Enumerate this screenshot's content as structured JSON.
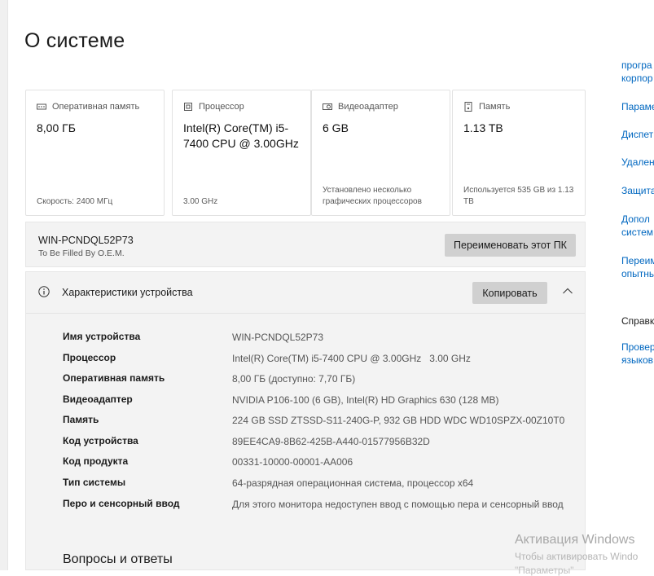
{
  "page": {
    "title": "О системе"
  },
  "cards": [
    {
      "label": "Оперативная память",
      "icon": "ram-icon",
      "value": "8,00 ГБ",
      "foot": "Скорость: 2400 МГц"
    },
    {
      "label": "Процессор",
      "icon": "cpu-icon",
      "value": "Intel(R) Core(TM) i5-7400 CPU @ 3.00GHz",
      "foot": "3.00 GHz"
    },
    {
      "label": "Видеоадаптер",
      "icon": "gpu-icon",
      "value": "6 GB",
      "foot": "Установлено несколько графических процессоров"
    },
    {
      "label": "Память",
      "icon": "storage-icon",
      "value": "1.13 TB",
      "foot": "Используется 535 GB из 1.13 TB"
    }
  ],
  "pc": {
    "name": "WIN-PCNDQL52P73",
    "oem": "To Be Filled By O.E.M.",
    "rename_label": "Переименовать этот ПК"
  },
  "specs": {
    "title": "Характеристики устройства",
    "copy_label": "Копировать",
    "rows": [
      {
        "label": "Имя устройства",
        "value": "WIN-PCNDQL52P73"
      },
      {
        "label": "Процессор",
        "value": "Intel(R) Core(TM) i5-7400 CPU @ 3.00GHz   3.00 GHz"
      },
      {
        "label": "Оперативная память",
        "value": "8,00 ГБ (доступно: 7,70 ГБ)"
      },
      {
        "label": "Видеоадаптер",
        "value": "NVIDIA P106-100 (6 GB), Intel(R) HD Graphics 630 (128 MB)"
      },
      {
        "label": "Память",
        "value": "224 GB SSD ZTSSD-S11-240G-P, 932 GB HDD WDC WD10SPZX-00Z10T0"
      },
      {
        "label": "Код устройства",
        "value": "89EE4CA9-8B62-425B-A440-01577956B32D"
      },
      {
        "label": "Код продукта",
        "value": "00331-10000-00001-AA006"
      },
      {
        "label": "Тип системы",
        "value": "64-разрядная операционная система, процессор x64"
      },
      {
        "label": "Перо и сенсорный ввод",
        "value": "Для этого монитора недоступен ввод с помощью пера и сенсорный ввод"
      }
    ]
  },
  "qa": {
    "title": "Вопросы и ответы"
  },
  "sidebar": {
    "links": [
      {
        "line1": "програ",
        "line2": "корпор"
      },
      {
        "line1": "Параме",
        "line2": ""
      },
      {
        "line1": "Диспет",
        "line2": ""
      },
      {
        "line1": "Удален",
        "line2": ""
      },
      {
        "line1": "Защита",
        "line2": ""
      },
      {
        "line1": "Допол",
        "line2": "систем"
      },
      {
        "line1": "Переим",
        "line2": "опытны"
      }
    ],
    "help_heading": "Справк",
    "help_link": {
      "line1": "Провер",
      "line2": "языков"
    }
  },
  "watermark": {
    "title": "Активация Windows",
    "subtitle": "Чтобы активировать Windo",
    "subtitle2": "\"Параметры\""
  },
  "colors": {
    "accent_link": "#0067c0",
    "button": "#d0d0d0",
    "panel": "#f3f3f3"
  }
}
